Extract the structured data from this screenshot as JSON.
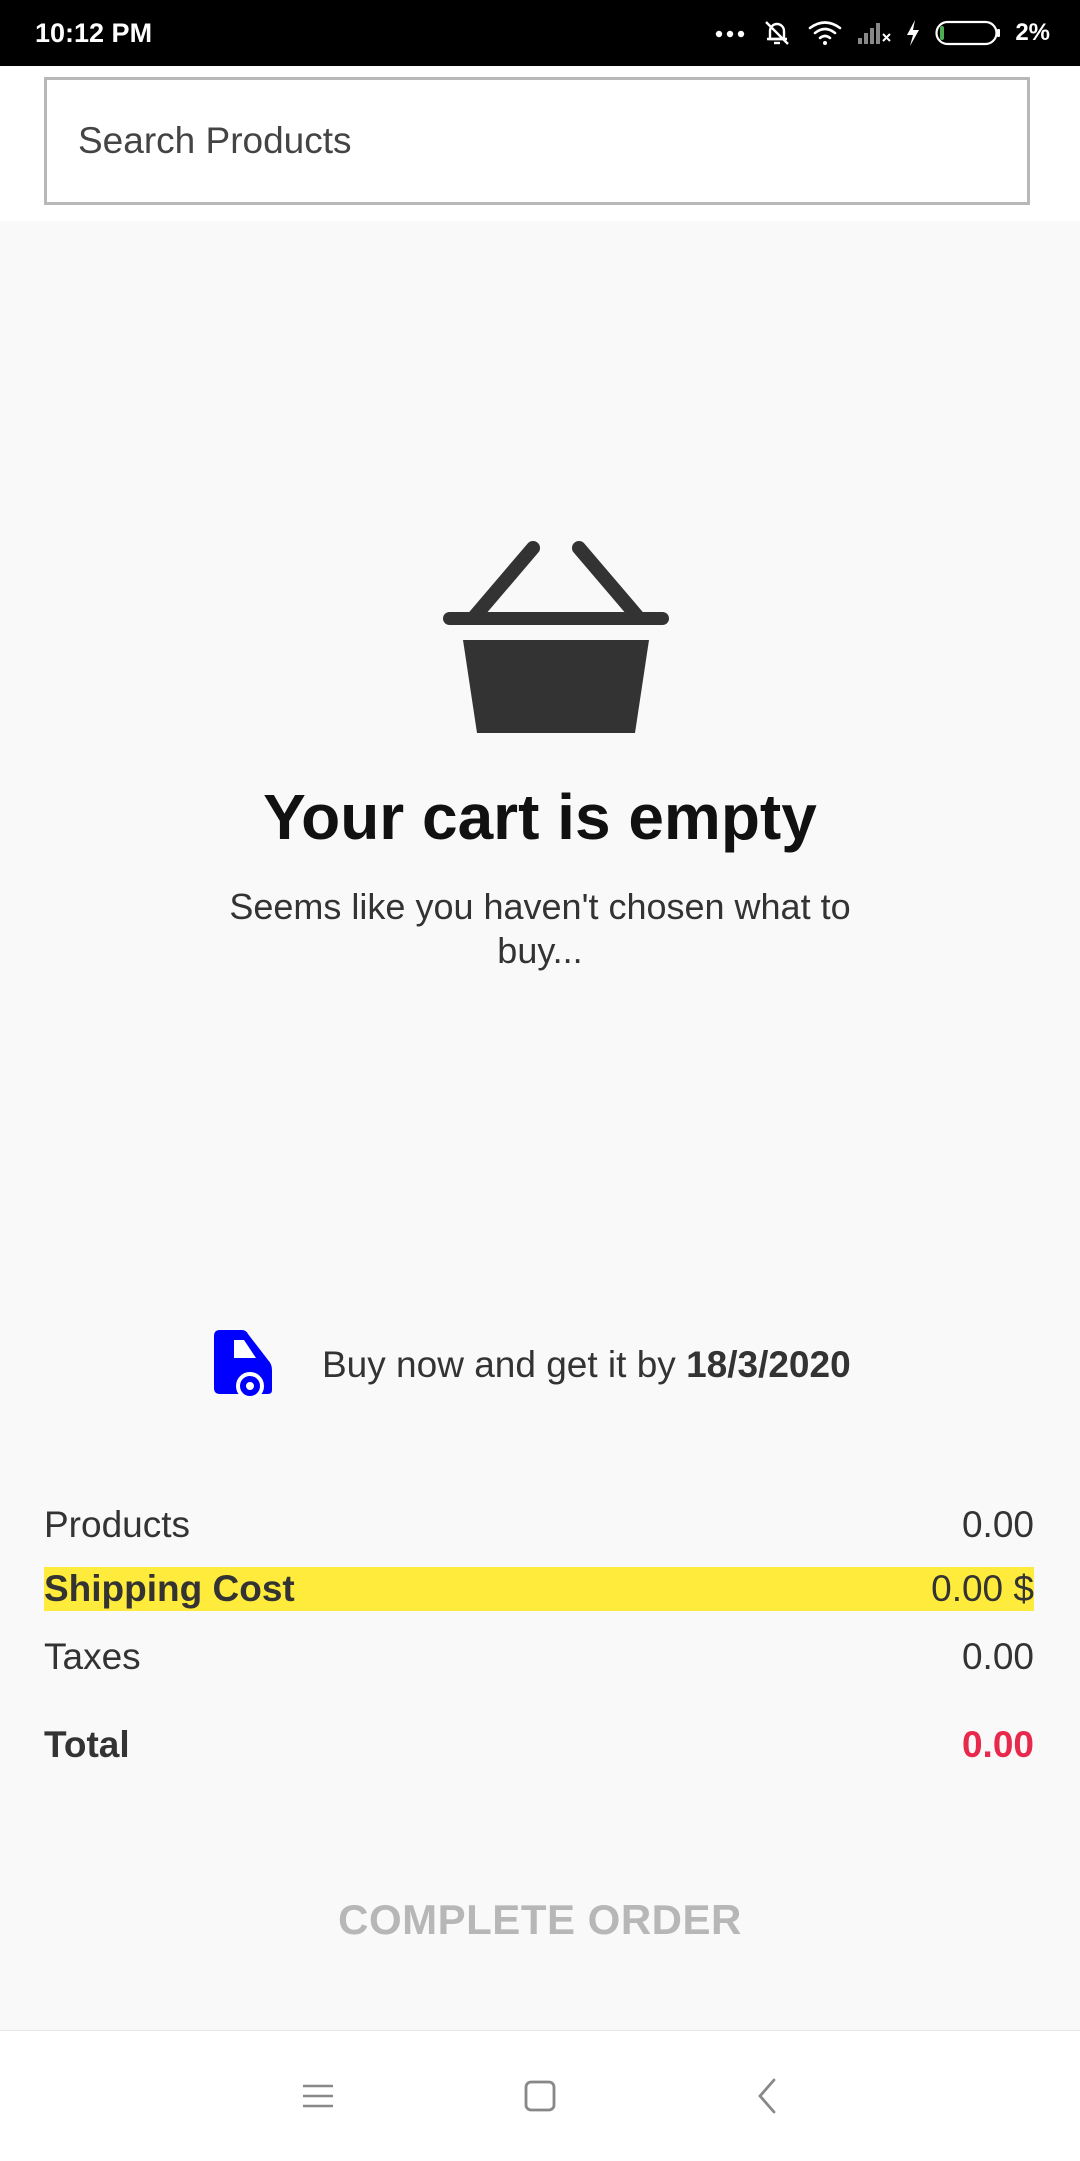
{
  "status_bar": {
    "time": "10:12 PM",
    "battery": "2%"
  },
  "search": {
    "placeholder": "Search Products"
  },
  "empty_state": {
    "title": "Your cart is empty",
    "subtitle": "Seems like you haven't chosen what to buy...",
    "icon": "basket-icon"
  },
  "delivery": {
    "text": "Buy now and get it by ",
    "date": "18/3/2020",
    "icon": "truck-icon",
    "icon_color": "#0000ff"
  },
  "summary": {
    "products_label": "Products",
    "products_value": "0.00",
    "shipping_label": "Shipping Cost",
    "shipping_value": "0.00 $",
    "shipping_highlight": "#ffeb3b",
    "taxes_label": "Taxes",
    "taxes_value": "0.00",
    "total_label": "Total",
    "total_value": "0.00",
    "total_color": "#e8294c"
  },
  "actions": {
    "complete_order": "COMPLETE ORDER"
  },
  "nav": {
    "icons": [
      "menu-icon",
      "home-square-icon",
      "back-chevron-icon"
    ]
  }
}
